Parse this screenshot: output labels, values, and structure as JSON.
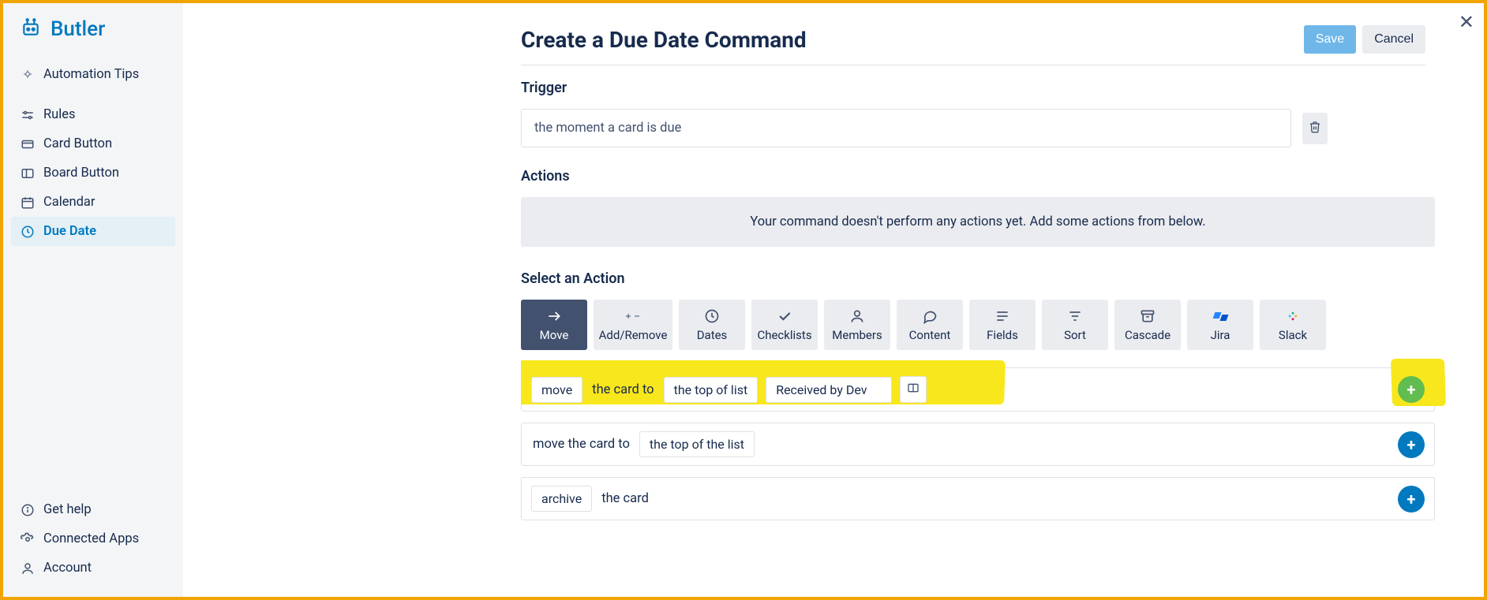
{
  "brand": "Butler",
  "sidebar": {
    "items": [
      {
        "label": "Automation Tips"
      },
      {
        "label": "Rules"
      },
      {
        "label": "Card Button"
      },
      {
        "label": "Board Button"
      },
      {
        "label": "Calendar"
      },
      {
        "label": "Due Date"
      }
    ],
    "active_index": 5,
    "footer": [
      {
        "label": "Get help"
      },
      {
        "label": "Connected Apps"
      },
      {
        "label": "Account"
      }
    ]
  },
  "header": {
    "title": "Create a Due Date Command",
    "save": "Save",
    "cancel": "Cancel"
  },
  "trigger": {
    "label": "Trigger",
    "text": "the moment a card is due"
  },
  "actions": {
    "label": "Actions",
    "empty": "Your command doesn't perform any actions yet. Add some actions from below."
  },
  "select_action": {
    "label": "Select an Action",
    "tabs": [
      "Move",
      "Add/Remove",
      "Dates",
      "Checklists",
      "Members",
      "Content",
      "Fields",
      "Sort",
      "Cascade",
      "Jira",
      "Slack"
    ],
    "active_index": 0
  },
  "rows": {
    "r1": {
      "move": "move",
      "card_to": "the card to",
      "top_of_list": "the top of list",
      "list_name": "Received by Dev"
    },
    "r2": {
      "prefix": "move the card to",
      "top_of_the_list": "the top of the list"
    },
    "r3": {
      "archive": "archive",
      "the_card": "the card"
    }
  }
}
